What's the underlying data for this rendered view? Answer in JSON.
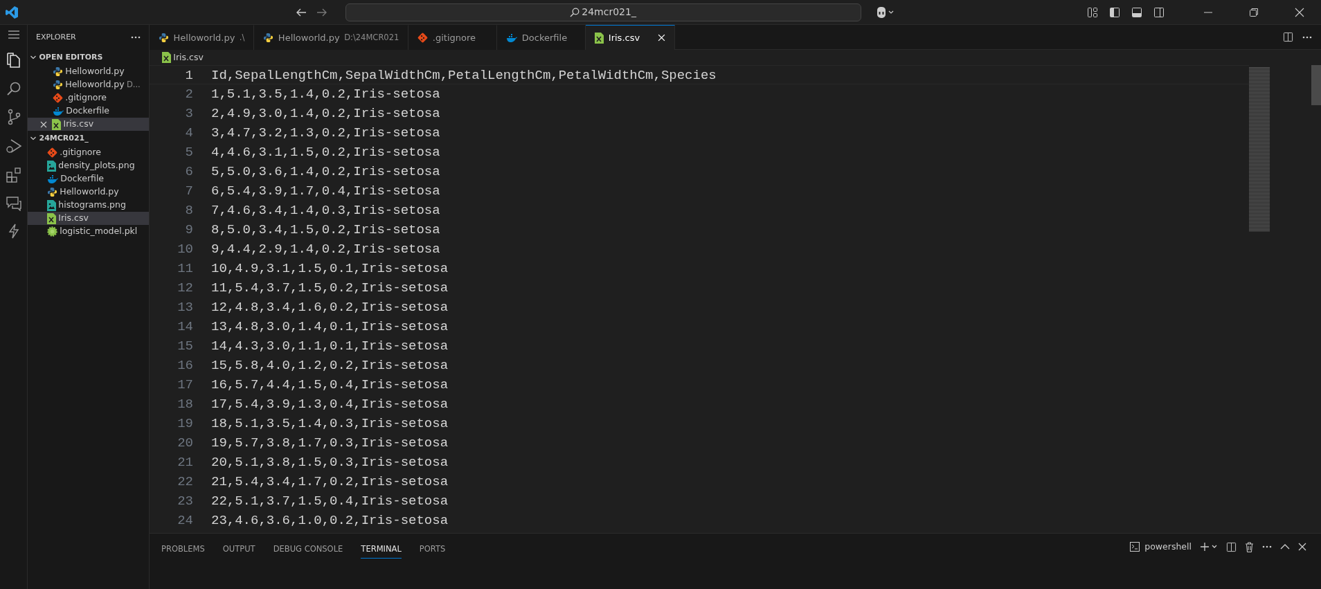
{
  "title_bar": {
    "search_text": "24mcr021_"
  },
  "sidebar": {
    "title": "EXPLORER",
    "open_editors": {
      "title": "OPEN EDITORS",
      "expanded": true,
      "items": [
        {
          "name": "Helloworld.py",
          "kind": "python",
          "selected": false
        },
        {
          "name": "Helloworld.py",
          "description": "D...",
          "kind": "python",
          "selected": false
        },
        {
          "name": ".gitignore",
          "kind": "git",
          "selected": false
        },
        {
          "name": "Dockerfile",
          "kind": "docker",
          "selected": false
        },
        {
          "name": "Iris.csv",
          "kind": "csv",
          "selected": true
        }
      ]
    },
    "folder": {
      "title": "24MCR021_",
      "expanded": true,
      "items": [
        {
          "name": ".gitignore",
          "kind": "git",
          "selected": false
        },
        {
          "name": "density_plots.png",
          "kind": "image",
          "selected": false
        },
        {
          "name": "Dockerfile",
          "kind": "docker",
          "selected": false
        },
        {
          "name": "Helloworld.py",
          "kind": "python",
          "selected": false
        },
        {
          "name": "histograms.png",
          "kind": "image",
          "selected": false
        },
        {
          "name": "Iris.csv",
          "kind": "csv",
          "selected": true
        },
        {
          "name": "logistic_model.pkl",
          "kind": "gear",
          "selected": false
        }
      ]
    }
  },
  "tabs": [
    {
      "label": "Helloworld.py",
      "description": ".\\",
      "kind": "python",
      "selected": false
    },
    {
      "label": "Helloworld.py",
      "description": "D:\\24MCR021",
      "kind": "python",
      "selected": false
    },
    {
      "label": ".gitignore",
      "kind": "git",
      "selected": false
    },
    {
      "label": "Dockerfile",
      "kind": "docker",
      "selected": false
    },
    {
      "label": "Iris.csv",
      "kind": "csv",
      "selected": true
    }
  ],
  "breadcrumb": {
    "label": "Iris.csv",
    "kind": "csv"
  },
  "editor": {
    "lines": [
      {
        "number": "1",
        "text": "Id,SepalLengthCm,SepalWidthCm,PetalLengthCm,PetalWidthCm,Species",
        "current": true
      },
      {
        "number": "2",
        "text": "1,5.1,3.5,1.4,0.2,Iris-setosa",
        "current": false
      },
      {
        "number": "3",
        "text": "2,4.9,3.0,1.4,0.2,Iris-setosa",
        "current": false
      },
      {
        "number": "4",
        "text": "3,4.7,3.2,1.3,0.2,Iris-setosa",
        "current": false
      },
      {
        "number": "5",
        "text": "4,4.6,3.1,1.5,0.2,Iris-setosa",
        "current": false
      },
      {
        "number": "6",
        "text": "5,5.0,3.6,1.4,0.2,Iris-setosa",
        "current": false
      },
      {
        "number": "7",
        "text": "6,5.4,3.9,1.7,0.4,Iris-setosa",
        "current": false
      },
      {
        "number": "8",
        "text": "7,4.6,3.4,1.4,0.3,Iris-setosa",
        "current": false
      },
      {
        "number": "9",
        "text": "8,5.0,3.4,1.5,0.2,Iris-setosa",
        "current": false
      },
      {
        "number": "10",
        "text": "9,4.4,2.9,1.4,0.2,Iris-setosa",
        "current": false
      },
      {
        "number": "11",
        "text": "10,4.9,3.1,1.5,0.1,Iris-setosa",
        "current": false
      },
      {
        "number": "12",
        "text": "11,5.4,3.7,1.5,0.2,Iris-setosa",
        "current": false
      },
      {
        "number": "13",
        "text": "12,4.8,3.4,1.6,0.2,Iris-setosa",
        "current": false
      },
      {
        "number": "14",
        "text": "13,4.8,3.0,1.4,0.1,Iris-setosa",
        "current": false
      },
      {
        "number": "15",
        "text": "14,4.3,3.0,1.1,0.1,Iris-setosa",
        "current": false
      },
      {
        "number": "16",
        "text": "15,5.8,4.0,1.2,0.2,Iris-setosa",
        "current": false
      },
      {
        "number": "17",
        "text": "16,5.7,4.4,1.5,0.4,Iris-setosa",
        "current": false
      },
      {
        "number": "18",
        "text": "17,5.4,3.9,1.3,0.4,Iris-setosa",
        "current": false
      },
      {
        "number": "19",
        "text": "18,5.1,3.5,1.4,0.3,Iris-setosa",
        "current": false
      },
      {
        "number": "20",
        "text": "19,5.7,3.8,1.7,0.3,Iris-setosa",
        "current": false
      },
      {
        "number": "21",
        "text": "20,5.1,3.8,1.5,0.3,Iris-setosa",
        "current": false
      },
      {
        "number": "22",
        "text": "21,5.4,3.4,1.7,0.2,Iris-setosa",
        "current": false
      },
      {
        "number": "23",
        "text": "22,5.1,3.7,1.5,0.4,Iris-setosa",
        "current": false
      },
      {
        "number": "24",
        "text": "23,4.6,3.6,1.0,0.2,Iris-setosa",
        "current": false
      }
    ]
  },
  "panel": {
    "tabs": [
      {
        "label": "PROBLEMS",
        "selected": false
      },
      {
        "label": "OUTPUT",
        "selected": false
      },
      {
        "label": "DEBUG CONSOLE",
        "selected": false
      },
      {
        "label": "TERMINAL",
        "selected": true
      },
      {
        "label": "PORTS",
        "selected": false
      }
    ],
    "terminal_name": "powershell"
  }
}
